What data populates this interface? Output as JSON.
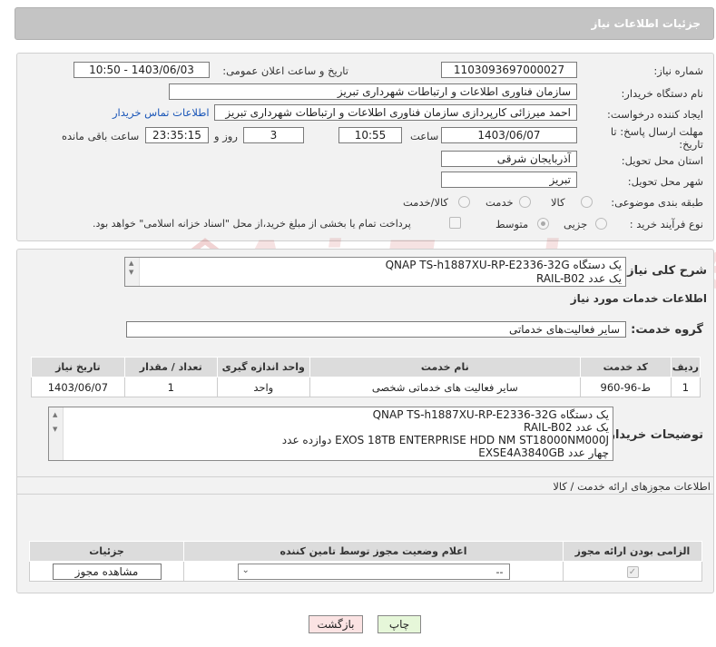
{
  "header": {
    "title": "جزئیات اطلاعات نیاز"
  },
  "form": {
    "need_number_label": "شماره نیاز:",
    "need_number": "1103093697000027",
    "announce_label": "تاریخ و ساعت اعلان عمومی:",
    "announce_value": "1403/06/03 - 10:50",
    "buyer_org_label": "نام دستگاه خریدار:",
    "buyer_org": "سازمان فناوری اطلاعات و ارتباطات شهرداری تبریز",
    "creator_label": "ایجاد کننده درخواست:",
    "creator": "احمد میرزائی کارپردازی سازمان فناوری اطلاعات و ارتباطات شهرداری تبریز",
    "contact_link": "اطلاعات تماس خریدار",
    "deadline_label_1": "مهلت ارسال پاسخ: تا",
    "deadline_label_2": "تاریخ:",
    "deadline_date": "1403/06/07",
    "hour_label": "ساعت",
    "deadline_time": "10:55",
    "days_value": "3",
    "days_label": "روز و",
    "remaining_time": "23:35:15",
    "remaining_label": "ساعت باقی مانده",
    "province_label": "استان محل تحویل:",
    "province": "آذربایجان شرقی",
    "city_label": "شهر محل تحویل:",
    "city": "تبریز",
    "category_label": "طبقه بندی موضوعی:",
    "category_options": [
      "کالا",
      "خدمت",
      "کالا/خدمت"
    ],
    "process_label": "نوع فرآیند خرید :",
    "process_options": [
      "جزیی",
      "متوسط"
    ],
    "payment_note": "پرداخت تمام یا بخشی از مبلغ خرید،از محل \"اسناد خزانه اسلامی\" خواهد بود."
  },
  "summary": {
    "label": "شرح کلی نیاز:",
    "lines": [
      "QNAP TS-h1887XU-RP-E2336-32G  یک دستگاه",
      "RAIL-B02  یک عدد"
    ]
  },
  "services": {
    "section_title": "اطلاعات خدمات مورد نیاز",
    "group_label": "گروه خدمت:",
    "group_value": "سایر فعالیت‌های خدماتی",
    "columns": [
      "ردیف",
      "کد خدمت",
      "نام خدمت",
      "واحد اندازه گیری",
      "تعداد / مقدار",
      "تاریخ نیاز"
    ],
    "rows": [
      [
        "1",
        "ط-96-960",
        "سایر فعالیت های خدماتی شخصی",
        "واحد",
        "1",
        "1403/06/07"
      ]
    ]
  },
  "buyer_notes": {
    "label": "توضیحات خریدار:",
    "lines": [
      "QNAP TS-h1887XU-RP-E2336-32G  یک دستگاه",
      "RAIL-B02  یک عدد",
      "EXOS 18TB ENTERPRISE HDD NM ST18000NM000J دوازده عدد",
      "EXSE4A3840GB  چهار عدد"
    ]
  },
  "permits": {
    "section_title": "اطلاعات مجوزهای ارائه خدمت / کالا",
    "columns": [
      "الزامی بودن ارائه مجوز",
      "اعلام وضعیت مجوز توسط تامین کننده",
      "جزئیات"
    ],
    "select_value": "--",
    "view_button": "مشاهده مجوز"
  },
  "footer": {
    "print_button": "چاپ",
    "back_button": "بازگشت"
  },
  "watermark": {
    "text": "AriaTender.net"
  },
  "colors": {
    "header_bg": "#c2c2c2",
    "panel_bg": "#f2f2f2",
    "link": "#1a56b8",
    "print_btn": "#e6f7d9",
    "back_btn": "#fbe3e3"
  }
}
